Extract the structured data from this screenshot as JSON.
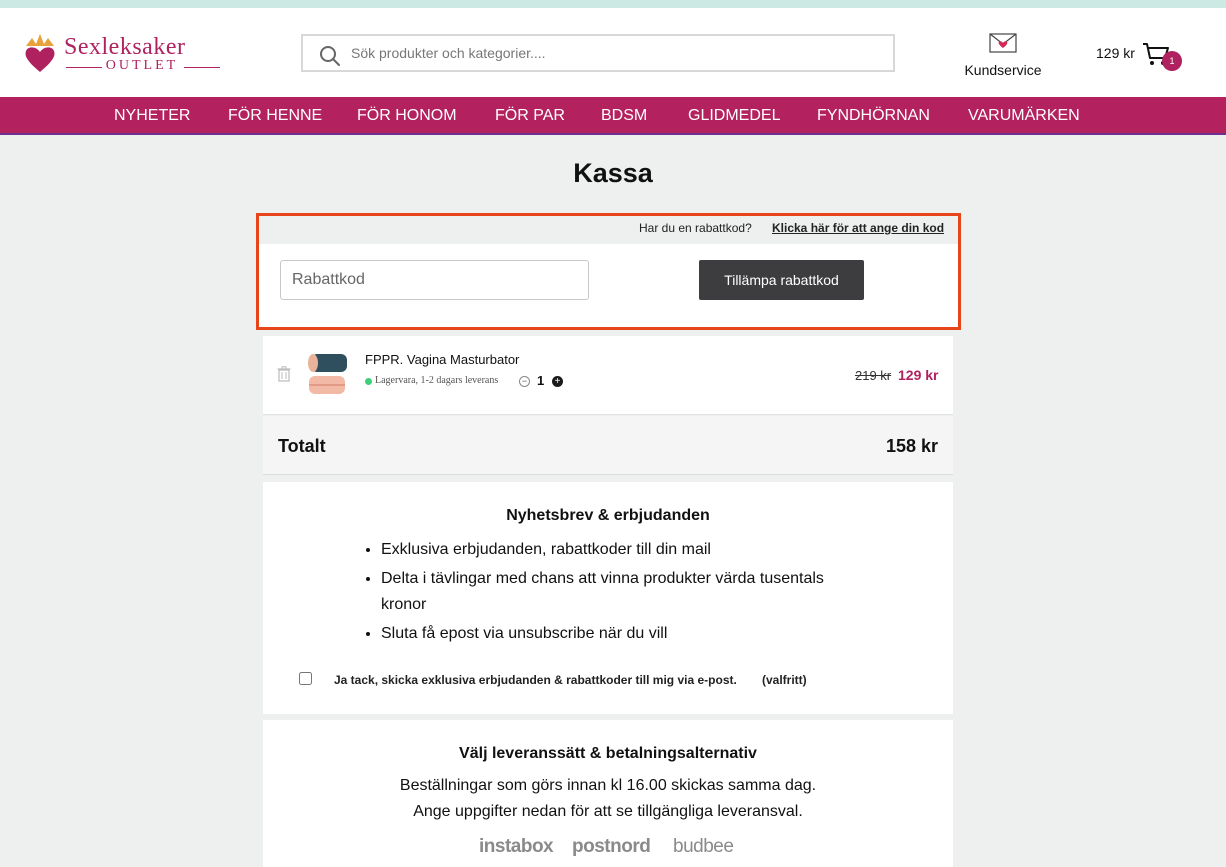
{
  "header": {
    "logo": {
      "main": "Sexleksaker",
      "sub": "OUTLET"
    },
    "search": {
      "placeholder": "Sök produkter och kategorier...."
    },
    "customer_service_label": "Kundservice",
    "cart": {
      "total": "129 kr",
      "count": "1"
    }
  },
  "nav": {
    "items": [
      "NYHETER",
      "FÖR HENNE",
      "FÖR HONOM",
      "FÖR PAR",
      "BDSM",
      "GLIDMEDEL",
      "FYNDHÖRNAN",
      "VARUMÄRKEN"
    ]
  },
  "page_title": "Kassa",
  "coupon": {
    "question": "Har du en rabattkod?",
    "link_label": "Klicka här för att ange din kod",
    "input_placeholder": "Rabattkod",
    "apply_label": "Tillämpa rabattkod"
  },
  "cart_item": {
    "name": "FPPR. Vagina Masturbator",
    "stock": "Lagervara, 1-2 dagars leverans",
    "quantity": "1",
    "price_old": "219 kr",
    "price_new": "129 kr"
  },
  "totals": {
    "label": "Totalt",
    "value": "158 kr"
  },
  "newsletter": {
    "title": "Nyhetsbrev & erbjudanden",
    "bullets": [
      "Exklusiva erbjudanden, rabattkoder till din mail",
      "Delta i tävlingar med chans att vinna produkter värda tusentals kronor",
      "Sluta få epost via unsubscribe när du vill"
    ],
    "consent": "Ja tack, skicka exklusiva erbjudanden & rabattkoder till mig via e-post.",
    "optional": "(valfritt)"
  },
  "shipping": {
    "title": "Välj leveranssätt & betalningsalternativ",
    "line1": "Beställningar som görs innan kl 16.00 skickas samma dag.",
    "line2": "Ange uppgifter nedan för att se tillgängliga leveransval.",
    "carriers": [
      "instabox",
      "postnord",
      "budbee"
    ]
  },
  "colors": {
    "brand": "#b3225e",
    "highlight": "#e8441a",
    "button": "#3d3d40",
    "stock_ok": "#3fcf7a"
  },
  "icons": [
    "search-icon",
    "mail-icon",
    "cart-icon",
    "trash-icon",
    "minus-icon",
    "plus-icon"
  ]
}
